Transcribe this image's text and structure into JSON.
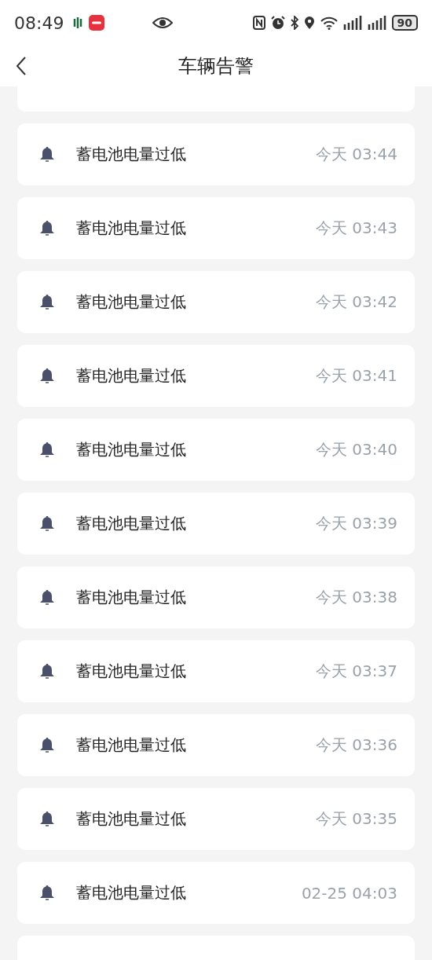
{
  "status_bar": {
    "time": "08:49",
    "battery": "90"
  },
  "header": {
    "title": "车辆告警"
  },
  "alerts": [
    {
      "message": "蓄电池电量过低",
      "time": "今天 03:44"
    },
    {
      "message": "蓄电池电量过低",
      "time": "今天 03:43"
    },
    {
      "message": "蓄电池电量过低",
      "time": "今天 03:42"
    },
    {
      "message": "蓄电池电量过低",
      "time": "今天 03:41"
    },
    {
      "message": "蓄电池电量过低",
      "time": "今天 03:40"
    },
    {
      "message": "蓄电池电量过低",
      "time": "今天 03:39"
    },
    {
      "message": "蓄电池电量过低",
      "time": "今天 03:38"
    },
    {
      "message": "蓄电池电量过低",
      "time": "今天 03:37"
    },
    {
      "message": "蓄电池电量过低",
      "time": "今天 03:36"
    },
    {
      "message": "蓄电池电量过低",
      "time": "今天 03:35"
    },
    {
      "message": "蓄电池电量过低",
      "time": "02-25 04:03"
    }
  ]
}
